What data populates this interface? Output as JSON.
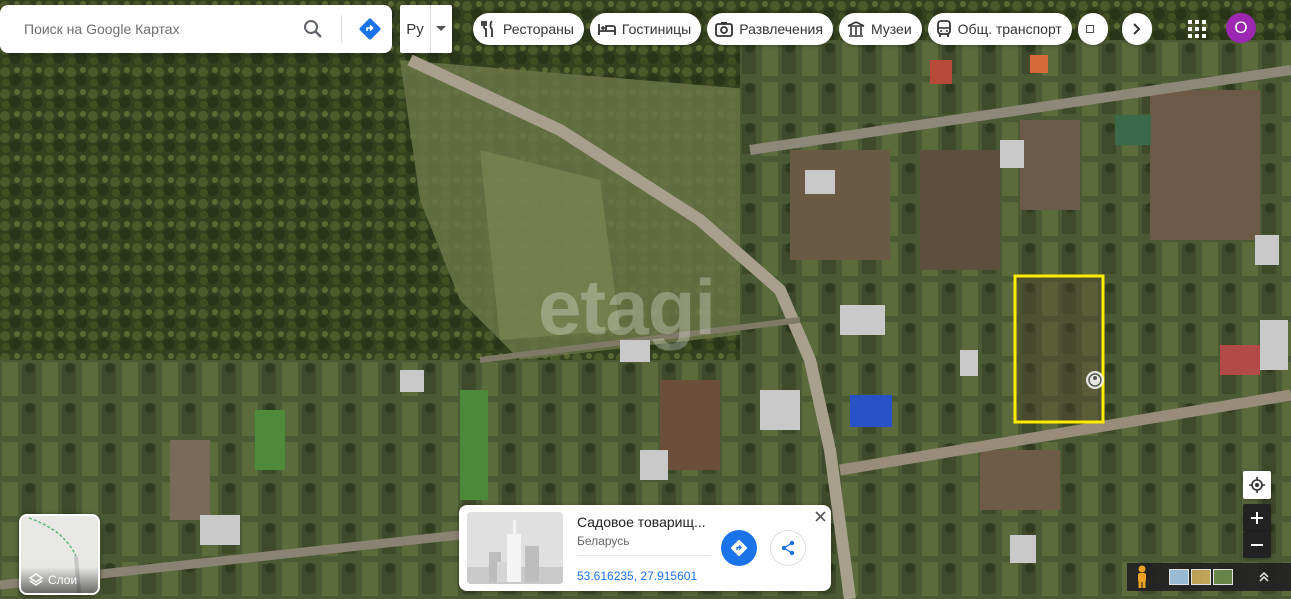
{
  "search": {
    "placeholder": "Поиск на Google Картах"
  },
  "language": {
    "code": "Ру"
  },
  "categories": [
    {
      "label": "Рестораны",
      "icon": "fork-knife-icon"
    },
    {
      "label": "Гостиницы",
      "icon": "bed-icon"
    },
    {
      "label": "Развлечения",
      "icon": "camera-icon"
    },
    {
      "label": "Музеи",
      "icon": "museum-icon"
    },
    {
      "label": "Общ. транспорт",
      "icon": "bus-icon"
    }
  ],
  "account": {
    "initial": "O",
    "color": "#9c27b0"
  },
  "watermark": "etagi",
  "place_card": {
    "title": "Садовое товарищ...",
    "subtitle": "Беларусь",
    "coordinates": "53.616235, 27.915601"
  },
  "layers": {
    "label": "Слои"
  },
  "colors": {
    "accent": "#1a73e8",
    "highlight": "#ffeb00"
  }
}
